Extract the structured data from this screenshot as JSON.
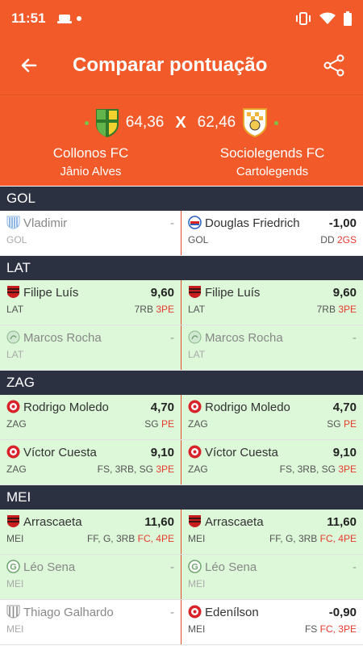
{
  "status": {
    "time": "11:51"
  },
  "appbar": {
    "title": "Comparar pontuação"
  },
  "score": {
    "left_value": "64,36",
    "separator": "X",
    "right_value": "62,46",
    "left_team": "Collonos FC",
    "left_owner": "Jânio Alves",
    "right_team": "Sociolegends FC",
    "right_owner": "Cartolegends"
  },
  "sections": {
    "gol": "GOL",
    "lat": "LAT",
    "zag": "ZAG",
    "mei": "MEI"
  },
  "rows": {
    "gol1": {
      "left": {
        "name": "Vladimir",
        "score": "-",
        "pos": "GOL",
        "stats": "",
        "neg": ""
      },
      "right": {
        "name": "Douglas Friedrich",
        "score": "-1,00",
        "pos": "GOL",
        "stats": "DD",
        "neg": "2GS"
      }
    },
    "lat1": {
      "left": {
        "name": "Filipe Luís",
        "score": "9,60",
        "pos": "LAT",
        "stats": "7RB",
        "neg": "3PE"
      },
      "right": {
        "name": "Filipe Luís",
        "score": "9,60",
        "pos": "LAT",
        "stats": "7RB",
        "neg": "3PE"
      }
    },
    "lat2": {
      "left": {
        "name": "Marcos Rocha",
        "score": "-",
        "pos": "LAT",
        "stats": "",
        "neg": ""
      },
      "right": {
        "name": "Marcos Rocha",
        "score": "-",
        "pos": "LAT",
        "stats": "",
        "neg": ""
      }
    },
    "zag1": {
      "left": {
        "name": "Rodrigo Moledo",
        "score": "4,70",
        "pos": "ZAG",
        "stats": "SG",
        "neg": "PE"
      },
      "right": {
        "name": "Rodrigo Moledo",
        "score": "4,70",
        "pos": "ZAG",
        "stats": "SG",
        "neg": "PE"
      }
    },
    "zag2": {
      "left": {
        "name": "Víctor Cuesta",
        "score": "9,10",
        "pos": "ZAG",
        "stats": "FS, 3RB, SG",
        "neg": "3PE"
      },
      "right": {
        "name": "Víctor Cuesta",
        "score": "9,10",
        "pos": "ZAG",
        "stats": "FS, 3RB, SG",
        "neg": "3PE"
      }
    },
    "mei1": {
      "left": {
        "name": "Arrascaeta",
        "score": "11,60",
        "pos": "MEI",
        "stats": "FF, G, 3RB",
        "neg": "FC, 4PE"
      },
      "right": {
        "name": "Arrascaeta",
        "score": "11,60",
        "pos": "MEI",
        "stats": "FF, G, 3RB",
        "neg": "FC, 4PE"
      }
    },
    "mei2": {
      "left": {
        "name": "Léo Sena",
        "score": "-",
        "pos": "MEI",
        "stats": "",
        "neg": ""
      },
      "right": {
        "name": "Léo Sena",
        "score": "-",
        "pos": "MEI",
        "stats": "",
        "neg": ""
      }
    },
    "mei3": {
      "left": {
        "name": "Thiago Galhardo",
        "score": "-",
        "pos": "MEI",
        "stats": "",
        "neg": ""
      },
      "right": {
        "name": "Edenílson",
        "score": "-0,90",
        "pos": "MEI",
        "stats": "FS",
        "neg": "FC, 3PE"
      }
    }
  },
  "colors": {
    "accent": "#f25a2a",
    "section_bg": "#2c3142",
    "played_bg": "#dcf8d8",
    "negative": "#e83a2e"
  },
  "icons": [
    "back-arrow-icon",
    "share-icon",
    "vibrate-icon",
    "wifi-icon",
    "battery-icon"
  ]
}
